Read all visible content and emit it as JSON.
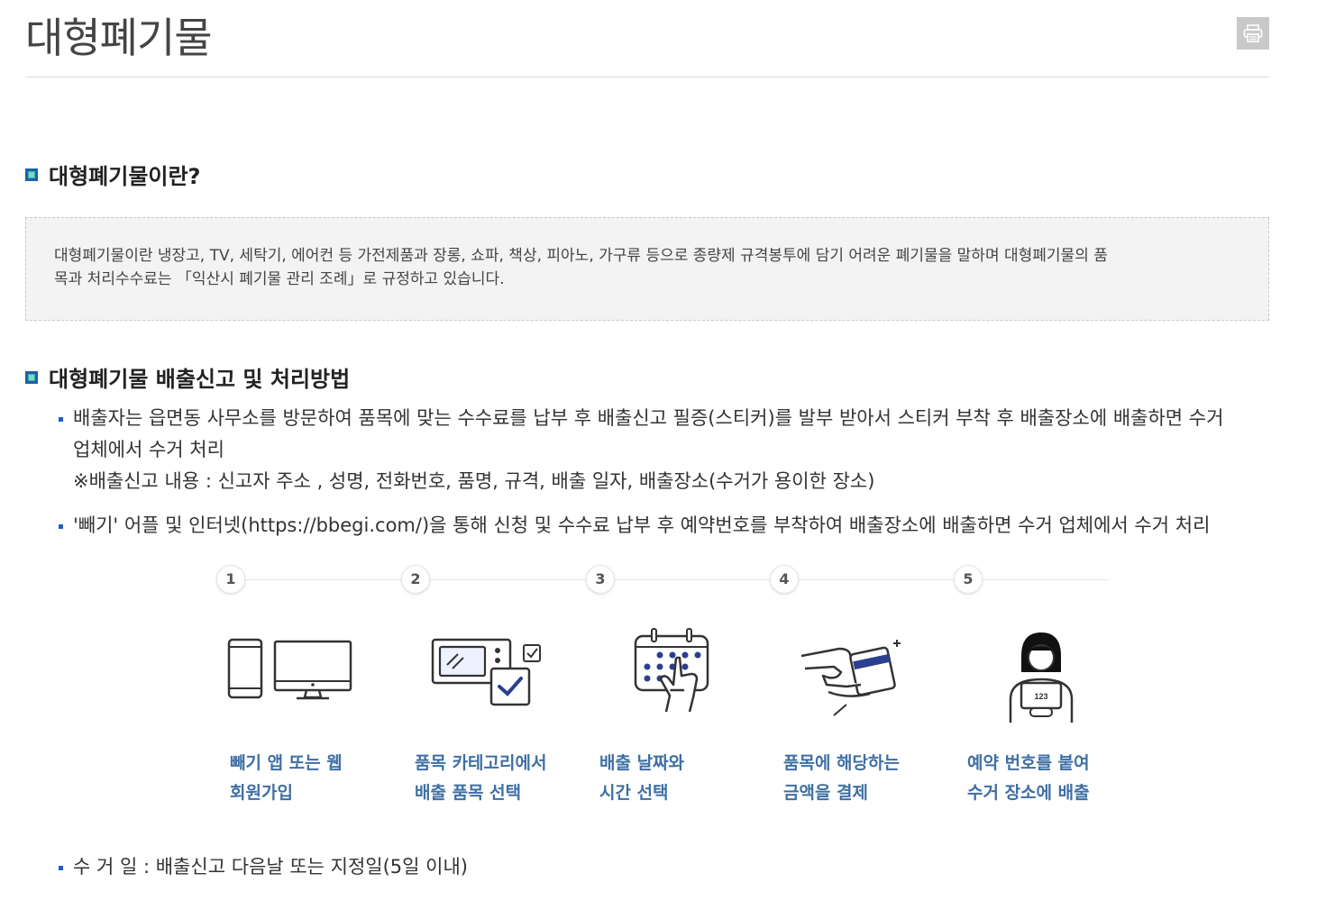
{
  "page": {
    "title": "대형폐기물",
    "print_icon": "printer-icon"
  },
  "section1": {
    "heading": "대형폐기물이란?",
    "text_line1": "대형폐기물이란 냉장고, TV, 세탁기, 에어컨 등 가전제품과 장롱, 쇼파, 책상, 피아노, 가구류 등으로 종량제 규격봉투에 담기 어려운 폐기물을 말하며 대형폐기물의 품",
    "text_line2": "목과 처리수수료는 「익산시 폐기물 관리 조례」로 규정하고 있습니다."
  },
  "section2": {
    "heading": "대형폐기물 배출신고 및 처리방법",
    "bullet1_line1": "배출자는 읍면동 사무소를 방문하여 품목에 맞는 수수료를 납부 후 배출신고 필증(스티커)를 발부 받아서 스티커 부착 후 배출장소에 배출하면 수거",
    "bullet1_line2": "업체에서 수거 처리",
    "bullet1_note": "※배출신고 내용 : 신고자 주소 , 성명, 전화번호, 품명, 규격, 배출 일자, 배출장소(수거가 용이한 장소)",
    "bullet2": "'빼기' 어플 및 인터넷(https://bbegi.com/)을 통해 신청 및 수수료 납부 후 예약번호를 부착하여 배출장소에 배출하면 수거 업체에서 수거 처리",
    "bullet3": "수 거 일 : 배출신고 다음날 또는 지정일(5일 이내)"
  },
  "steps": [
    {
      "num": "1",
      "line1": "빼기 앱 또는 웹",
      "line2": "회원가입",
      "icon": "phone-monitor-icon"
    },
    {
      "num": "2",
      "line1": "품목 카테고리에서",
      "line2": "배출 품목 선택",
      "icon": "microwave-checkbox-icon"
    },
    {
      "num": "3",
      "line1": "배출 날짜와",
      "line2": "시간 선택",
      "icon": "calendar-touch-icon"
    },
    {
      "num": "4",
      "line1": "품목에 해당하는",
      "line2": "금액을 결제",
      "icon": "card-payment-icon"
    },
    {
      "num": "5",
      "line1": "예약 번호를 붙여",
      "line2": "수거 장소에 배출",
      "icon": "person-number-sign-icon",
      "sign_text": "123"
    }
  ]
}
